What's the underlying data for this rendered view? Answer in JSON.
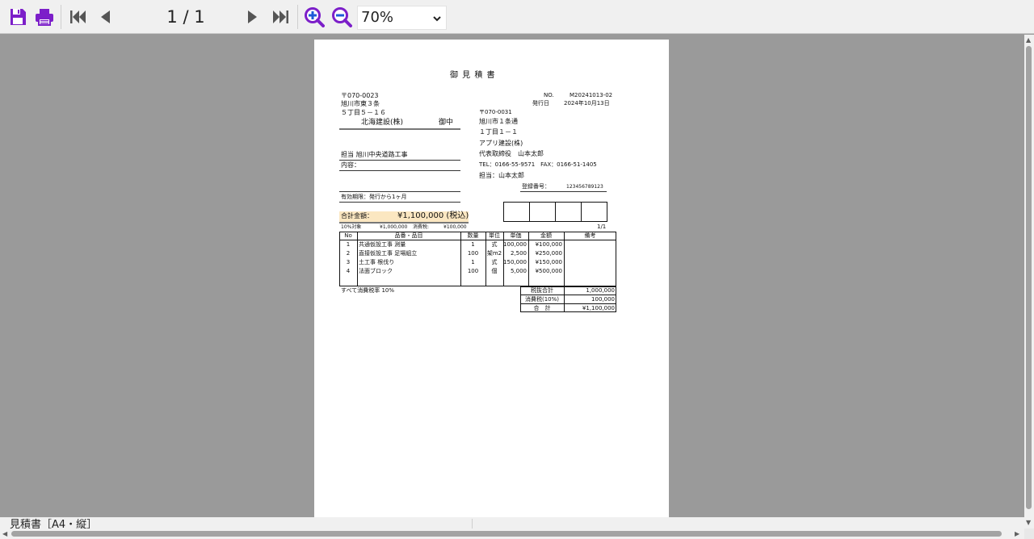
{
  "toolbar": {
    "page_indicator": "1 / 1",
    "zoom_value": "70%",
    "icons": [
      "save-icon",
      "print-icon",
      "first-page-icon",
      "prev-page-icon",
      "next-page-icon",
      "last-page-icon",
      "zoom-in-icon",
      "zoom-out-icon"
    ],
    "accent_color": "#7c1fc9"
  },
  "status": {
    "label": "見積書［A4・縦］"
  },
  "document": {
    "title": "御 見 積 書",
    "recipient": {
      "postal": "〒070-0023",
      "addr1": "旭川市東３条",
      "addr2": "５丁目５－１６",
      "name": "北海建設(株)",
      "honorific": "御中"
    },
    "project": {
      "tanto": "担当 旭川中央道路工事",
      "naiyo": "内容：",
      "validity": "有効期限：発行から1ヶ月"
    },
    "meta": {
      "no_label": "NO.",
      "no_value": "M20241013-02",
      "date_label": "発行日",
      "date_value": "2024年10月13日"
    },
    "issuer": {
      "postal": "〒070-0031",
      "addr1": "旭川市１条通",
      "addr2": "１丁目１－１",
      "company": "アプリ建設(株)",
      "rep": "代表取締役　山本太郎",
      "tel": "TEL：0166-55-9571　FAX：0166-51-1405",
      "staff": "担当：山本太郎",
      "reg_label": "登録番号：",
      "reg_value": "123456789123"
    },
    "total": {
      "label": "合計金額：",
      "value": "¥1,100,000 (税込)"
    },
    "tax_line": {
      "target_label": "10%対象",
      "target_value": "¥1,000,000",
      "tax_label": "消費税:",
      "tax_value": "¥100,000"
    },
    "page_no": "1/1",
    "table": {
      "headers": [
        "No",
        "品番・品目",
        "数量",
        "単位",
        "単価",
        "金額",
        "備考"
      ],
      "rows": [
        [
          "1",
          "共通仮設工事 測量",
          "1",
          "式",
          "100,000",
          "¥100,000",
          ""
        ],
        [
          "2",
          "直接仮設工事 足場組立",
          "100",
          "架m2",
          "2,500",
          "¥250,000",
          ""
        ],
        [
          "3",
          "土工事 根伐り",
          "1",
          "式",
          "150,000",
          "¥150,000",
          ""
        ],
        [
          "4",
          "法面ブロック",
          "100",
          "個",
          "5,000",
          "¥500,000",
          ""
        ]
      ]
    },
    "note": "すべて消費税率 10%",
    "summary": [
      {
        "label": "税抜合計",
        "value": "1,000,000"
      },
      {
        "label": "消費税(10%)",
        "value": "100,000"
      },
      {
        "label": "合　計",
        "value": "¥1,100,000"
      }
    ]
  }
}
